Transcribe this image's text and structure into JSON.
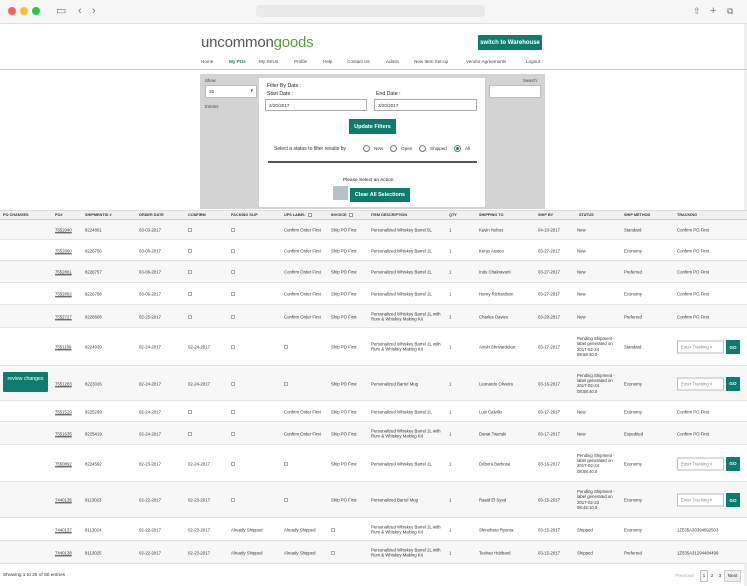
{
  "header": {
    "logo_part1": "uncommon",
    "logo_part2": "goods",
    "warehouse_button": "switch to Warehouse",
    "nav": [
      "Home",
      "My POs",
      "My SKUs",
      "Profile",
      "Help",
      "Contact Us",
      "Admin",
      "New Item Set-up",
      "Vendor Agreements",
      "Logout"
    ],
    "active_nav": "My POs"
  },
  "controls": {
    "show_label": "Show",
    "show_value": "25",
    "entries_label": "Entries",
    "search_label": "Search:",
    "filter_title": "Filter By Date :",
    "start_label": "Start Date :",
    "start_value": "2/20/2017",
    "end_label": "End Date :",
    "end_value": "3/20/2017",
    "update_button": "Update Filters",
    "status_prompt": "Select a status to filter results by",
    "statuses": [
      "New",
      "Open",
      "Shipped",
      "All"
    ],
    "selected_status": "All",
    "action_prompt": "Please Select an Action",
    "clear_button": "Clear All Selections"
  },
  "table": {
    "headers": [
      "PO CHANGES",
      "PO#",
      "SHIPMENTID #",
      "ORDER DATE",
      "CONFIRM",
      "PACKING SLIP",
      "UPS LABEL",
      "INVOICE",
      "ITEM DESCRIPTION",
      "QTY",
      "SHIPPING TO",
      "SHIP BY",
      "STATUS",
      "SHIP METHOD",
      "TRACKING"
    ],
    "tracking_placeholder": "Enter Tracking #",
    "go_label": "GO",
    "review_button": "review changes",
    "rows": [
      {
        "po": "7552940",
        "sid": "8224861",
        "order": "03-03-2017",
        "confirm": "",
        "ups": "Confirm Order First",
        "invoice": "Ship PO First",
        "item": "Personalized Whiskey Barrel 5L",
        "qty": "1",
        "ship_to": "Kevin Nobos",
        "ship_by": "04-10-2017",
        "status": "New",
        "method": "Standard",
        "tracking": "Confirm PO First",
        "packing": ""
      },
      {
        "po": "7552860",
        "sid": "8226756",
        "order": "03-06-2017",
        "confirm": "",
        "ups": "Confirm Order First",
        "invoice": "Ship PO First",
        "item": "Personalized Whiskey Barrel 2L",
        "qty": "1",
        "ship_to": "Kenjo Assieo",
        "ship_by": "03-27-2017",
        "status": "New",
        "method": "Economy",
        "tracking": "Confirm PO First",
        "packing": ""
      },
      {
        "po": "7552861",
        "sid": "8226757",
        "order": "03-06-2017",
        "confirm": "",
        "ups": "Confirm Order First",
        "invoice": "Ship PO First",
        "item": "Personalized Whiskey Barrel 2L",
        "qty": "1",
        "ship_to": "Indu Chakravarti",
        "ship_by": "03-27-2017",
        "status": "New",
        "method": "Preferred",
        "tracking": "Confirm PO First",
        "packing": ""
      },
      {
        "po": "7552862",
        "sid": "8226758",
        "order": "03-06-2017",
        "confirm": "",
        "ups": "Confirm Order First",
        "invoice": "Ship PO First",
        "item": "Personalized Whiskey Barrel 2L",
        "qty": "1",
        "ship_to": "Henry Richardson",
        "ship_by": "03-27-2017",
        "status": "New",
        "method": "Economy",
        "tracking": "Confirm PO First",
        "packing": ""
      },
      {
        "po": "7552727",
        "sid": "8226608",
        "order": "02-25-2017",
        "confirm": "",
        "ups": "Confirm Order First",
        "invoice": "Ship PO First",
        "item": "Personalized Whiskey Barrel 2L with Rum & Whiskey Making Kit",
        "qty": "1",
        "ship_to": "Charles Davies",
        "ship_by": "03-20-2017",
        "status": "New",
        "method": "Preferred",
        "tracking": "Confirm PO First",
        "packing": ""
      },
      {
        "po": "7551199",
        "sid": "8224939",
        "order": "02-24-2017",
        "confirm": "02-24-2017",
        "ups": "",
        "invoice": "Ship PO First",
        "item": "Personalized Whiskey Barrel 2L with Rum & Whiskey Making Kit",
        "qty": "1",
        "ship_to": "Anish Shrivardekar",
        "ship_by": "03-17-2017",
        "status": "Pending Shipment - label generated on 2017-02-24 08:58:40.0",
        "method": "Standard",
        "tracking": "",
        "packing": ""
      },
      {
        "po": "7551283",
        "sid": "8223026",
        "order": "02-24-2017",
        "confirm": "02-24-2017",
        "ups": "",
        "invoice": "Ship PO First",
        "item": "Personalized Barrel Mug",
        "qty": "1",
        "ship_to": "Leonardo Oliveira",
        "ship_by": "03-16-2017",
        "status": "Pending Shipment - label generated on 2017-02-24 08:58:40.0",
        "method": "Economy",
        "tracking": "",
        "packing": ""
      },
      {
        "po": "7551529",
        "sid": "8225299",
        "order": "02-24-2017",
        "confirm": "",
        "ups": "Confirm Order First",
        "invoice": "Ship PO First",
        "item": "Personalized Whiskey Barrel 2L",
        "qty": "1",
        "ship_to": "Luis Calvillo",
        "ship_by": "03-17-2017",
        "status": "New",
        "method": "Economy",
        "tracking": "Confirm PO First",
        "packing": ""
      },
      {
        "po": "7551635",
        "sid": "8225419",
        "order": "02-24-2017",
        "confirm": "",
        "ups": "Confirm Order First",
        "invoice": "Ship PO First",
        "item": "Personalized Whiskey Barrel 2L with Rum & Whiskey Making Kit",
        "qty": "1",
        "ship_to": "Danat Twerski",
        "ship_by": "03-17-2017",
        "status": "New",
        "method": "Expedited",
        "tracking": "Confirm PO First",
        "packing": ""
      },
      {
        "po": "7550892",
        "sid": "8224592",
        "order": "02-23-2017",
        "confirm": "02-24-2017",
        "ups": "",
        "invoice": "Ship PO First",
        "item": "Personalized Whiskey Barrel 2L",
        "qty": "1",
        "ship_to": "Débora Barbosa",
        "ship_by": "03-16-2017",
        "status": "Pending Shipment - label generated on 2017-02-24 08:58:40.0",
        "method": "Economy",
        "tracking": "",
        "packing": ""
      },
      {
        "po": "7440135",
        "sid": "8113023",
        "order": "02-22-2017",
        "confirm": "02-23-2017",
        "ups": "",
        "invoice": "Ship PO First",
        "item": "Personalized Barrel Mug",
        "qty": "1",
        "ship_to": "Raaid El Syed",
        "ship_by": "03-15-2017",
        "status": "Pending Shipment - label generated on 2017-02-23 08:45:10.0",
        "method": "Economy",
        "tracking": "",
        "packing": ""
      },
      {
        "po": "7440137",
        "sid": "8113024",
        "order": "02-22-2017",
        "confirm": "02-23-2017",
        "ups": "Already Shipped",
        "invoice": "",
        "item": "Personalized Whiskey Barrel 2L with Rum & Whiskey Making Kit",
        "qty": "1",
        "ship_to": "Shinohara Ryoma",
        "ship_by": "03-15-2017",
        "status": "Shipped",
        "method": "Economy",
        "tracking": "1Z535A30394692503",
        "packing": "Already Shipped"
      },
      {
        "po": "7440138",
        "sid": "8113025",
        "order": "02-22-2017",
        "confirm": "02-23-2017",
        "ups": "Already Shipped",
        "invoice": "",
        "item": "Personalized Whiskey Barrel 2L with Rum & Whiskey Making Kit",
        "qty": "1",
        "ship_to": "Teshao Hubbard",
        "ship_by": "03-15-2017",
        "status": "Shipped",
        "method": "Preferred",
        "tracking": "1Z535A31294484499",
        "packing": "Already Shipped"
      }
    ]
  },
  "footer": {
    "info": "Showing 1 to 25 of 60 entries",
    "previous": "Previous",
    "pages": [
      "1",
      "2",
      "3"
    ],
    "next": "Next"
  },
  "colors": {
    "accent": "#0e7c6d"
  }
}
